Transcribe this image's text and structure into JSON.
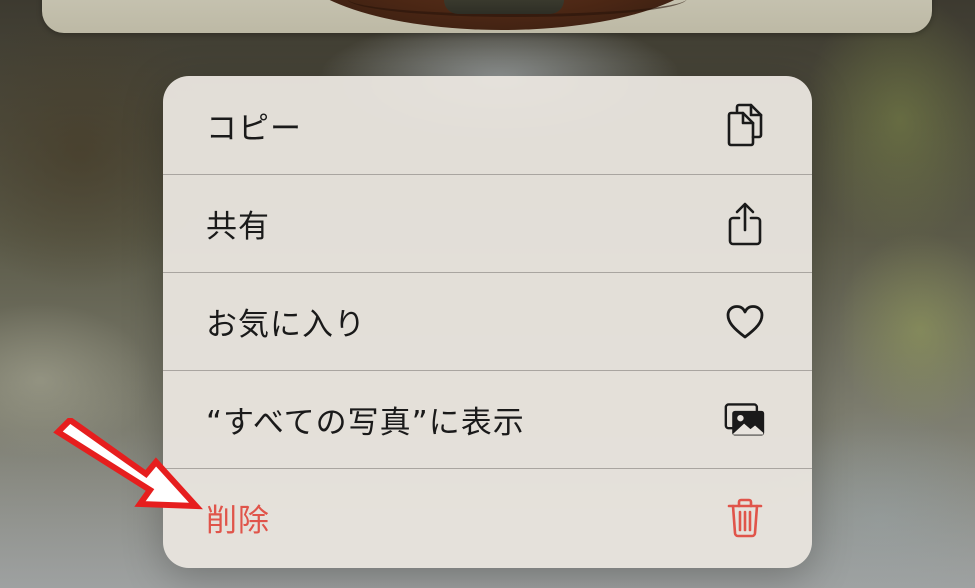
{
  "menu": {
    "items": [
      {
        "label": "コピー",
        "icon": "copy-icon"
      },
      {
        "label": "共有",
        "icon": "share-icon"
      },
      {
        "label": "お気に入り",
        "icon": "heart-icon"
      },
      {
        "label": "“すべての写真”に表示",
        "icon": "photos-icon"
      },
      {
        "label": "削除",
        "icon": "trash-icon"
      }
    ]
  },
  "colors": {
    "menu_background": "#e8e4de",
    "text": "#1a1a1a",
    "destructive": "#e0544a",
    "annotation": "#e61e1e"
  }
}
